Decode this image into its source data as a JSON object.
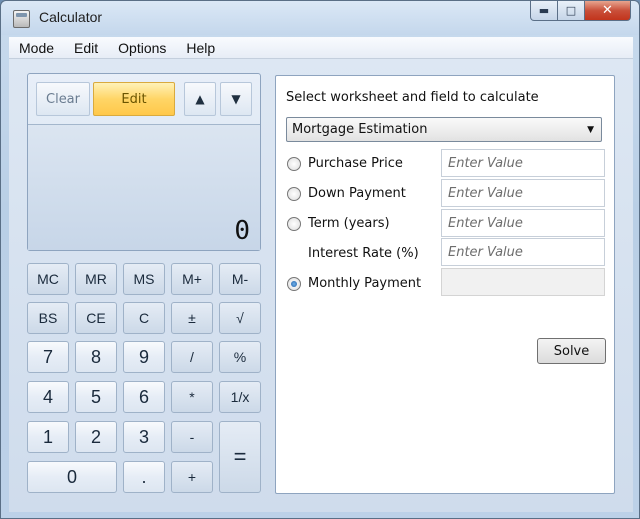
{
  "window": {
    "title": "Calculator",
    "icon": "calculator-icon",
    "controls": {
      "minimize": "▬",
      "maximize": "□",
      "close": "✕"
    }
  },
  "menu": [
    "Mode",
    "Edit",
    "Options",
    "Help"
  ],
  "history_toolbar": {
    "clear_label": "Clear",
    "edit_label": "Edit",
    "up_icon": "▲",
    "down_icon": "▼"
  },
  "display": {
    "value": "0"
  },
  "keypad": {
    "memory": [
      "MC",
      "MR",
      "MS",
      "M+",
      "M-"
    ],
    "row2": [
      "BS",
      "CE",
      "C",
      "±",
      "√"
    ],
    "row3": [
      "7",
      "8",
      "9",
      "/",
      "%"
    ],
    "row4": [
      "4",
      "5",
      "6",
      "*",
      "1/x"
    ],
    "row5": [
      "1",
      "2",
      "3",
      "-"
    ],
    "row6": [
      "0",
      ".",
      "+"
    ],
    "equals": "="
  },
  "worksheet": {
    "heading": "Select worksheet and field to calculate",
    "selected": "Mortgage Estimation",
    "fields": [
      {
        "label": "Purchase Price",
        "placeholder": "Enter Value",
        "radio": true,
        "checked": false
      },
      {
        "label": "Down Payment",
        "placeholder": "Enter Value",
        "radio": true,
        "checked": false
      },
      {
        "label": "Term (years)",
        "placeholder": "Enter Value",
        "radio": true,
        "checked": false
      },
      {
        "label": "Interest Rate (%)",
        "placeholder": "Enter Value",
        "radio": false,
        "checked": false
      },
      {
        "label": "Monthly Payment",
        "placeholder": "",
        "radio": true,
        "checked": true
      }
    ],
    "solve_label": "Solve"
  }
}
